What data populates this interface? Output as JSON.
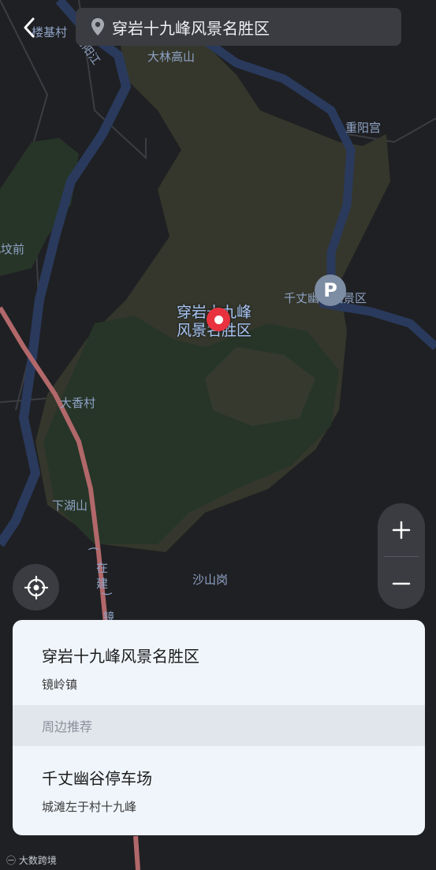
{
  "search": {
    "query": "穿岩十九峰风景名胜区"
  },
  "map": {
    "labels": [
      {
        "id": "loujicun",
        "text": "楼基村"
      },
      {
        "id": "puyangjiang",
        "text": "浦阳江"
      },
      {
        "id": "dalingaoshan",
        "text": "大林高山"
      },
      {
        "id": "chongyanggong",
        "text": "重阳宫"
      },
      {
        "id": "beifenqian",
        "text": "北坟前"
      },
      {
        "id": "qianzhang",
        "text": "千丈幽谷风景区"
      },
      {
        "id": "daxiangcun",
        "text": "大香村"
      },
      {
        "id": "xiahushan",
        "text": "下湖山"
      },
      {
        "id": "shashangang",
        "text": "沙山岗"
      },
      {
        "id": "zaijian",
        "text": "在建"
      },
      {
        "id": "zaijian_paren_open",
        "text": "("
      },
      {
        "id": "zaijian_paren_close",
        "text": ")"
      },
      {
        "id": "jing",
        "text": "镜"
      }
    ],
    "poi": {
      "name_line1": "穿岩十九峰",
      "name_line2": "风景名胜区"
    },
    "parking_icon": "parking-icon",
    "colors": {
      "background": "#1f2023",
      "river": "#2a3a5d",
      "scenic_area": "#34362c",
      "forest": "#283629",
      "road": "#b2686a",
      "label": "#8fa3c6",
      "marker": "#e8323f"
    }
  },
  "controls": {
    "zoom_in": "+",
    "zoom_out": "−"
  },
  "panel": {
    "place_name": "穿岩十九峰风景名胜区",
    "place_town": "镜岭镇",
    "nearby_header": "周边推荐",
    "nearby_items": [
      {
        "name": "千丈幽谷停车场",
        "address": "城滩左于村十九峰"
      }
    ]
  },
  "watermark": "大数跨境"
}
